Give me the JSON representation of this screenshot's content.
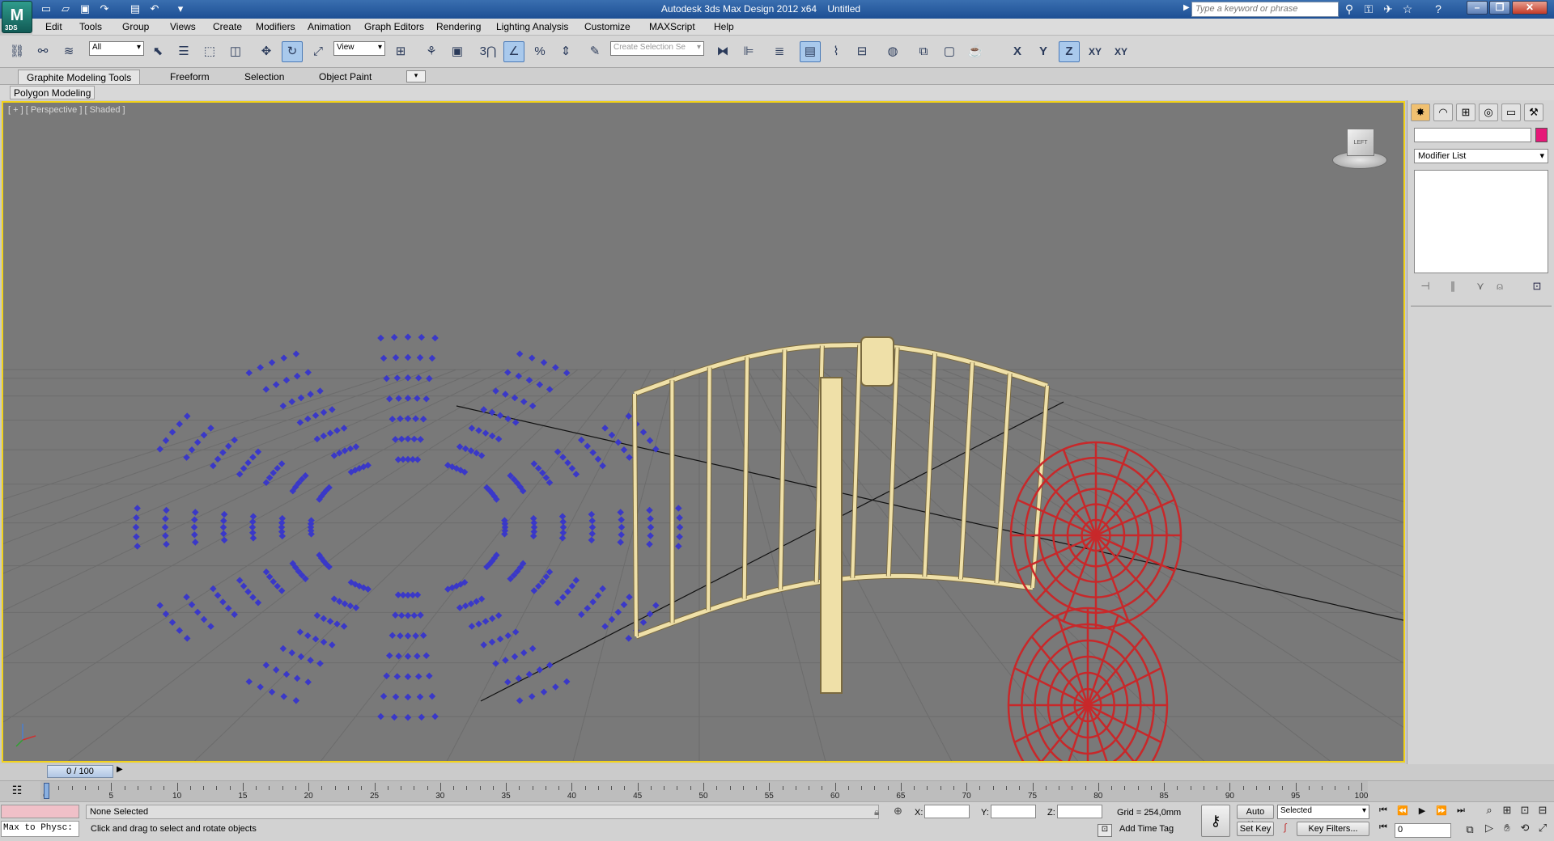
{
  "app": {
    "title": "Autodesk 3ds Max Design 2012 x64",
    "document": "Untitled",
    "logo": "3DS",
    "search_placeholder": "Type a keyword or phrase"
  },
  "menu": [
    "Edit",
    "Tools",
    "Group",
    "Views",
    "Create",
    "Modifiers",
    "Animation",
    "Graph Editors",
    "Rendering",
    "Lighting Analysis",
    "Customize",
    "MAXScript",
    "Help"
  ],
  "toolbar": {
    "selection_filter": "All",
    "reference_coord": "View",
    "named_selection_placeholder": "Create Selection Se",
    "axis_x": "X",
    "axis_y": "Y",
    "axis_z": "Z",
    "axis_xy": "XY",
    "axis_xy2": "XY",
    "snap_label": "3",
    "percent_snap": "%"
  },
  "ribbon": {
    "tabs": [
      "Graphite Modeling Tools",
      "Freeform",
      "Selection",
      "Object Paint"
    ],
    "active_tab": "Graphite Modeling Tools",
    "panel_label": "Polygon Modeling"
  },
  "viewport": {
    "label": "[ + ] [ Perspective ] [ Shaded ]",
    "viewcube_face": "LEFT",
    "border_color": "#f2d21a",
    "objects": {
      "spheres_color": "#3a38c8",
      "fence_color": "#efe0a8",
      "lattice_color": "#c8282a"
    }
  },
  "command_panel": {
    "modifier_list": "Modifier List",
    "object_color": "#e61878"
  },
  "timeline": {
    "slider_label": "0 / 100",
    "ticks": [
      "0",
      "5",
      "10",
      "15",
      "20",
      "25",
      "30",
      "35",
      "40",
      "45",
      "50",
      "55",
      "60",
      "65",
      "70",
      "75",
      "80",
      "85",
      "90",
      "95",
      "100"
    ]
  },
  "status": {
    "maxscript_listener": "Max to Physc:",
    "selection": "None Selected",
    "prompt": "Click and drag to select and rotate objects",
    "x_label": "X:",
    "y_label": "Y:",
    "z_label": "Z:",
    "grid": "Grid = 254,0mm",
    "add_time_tag": "Add Time Tag",
    "auto_key": "Auto Key",
    "set_key": "Set Key",
    "key_mode": "Selected",
    "key_filters": "Key Filters...",
    "current_frame": "0"
  }
}
